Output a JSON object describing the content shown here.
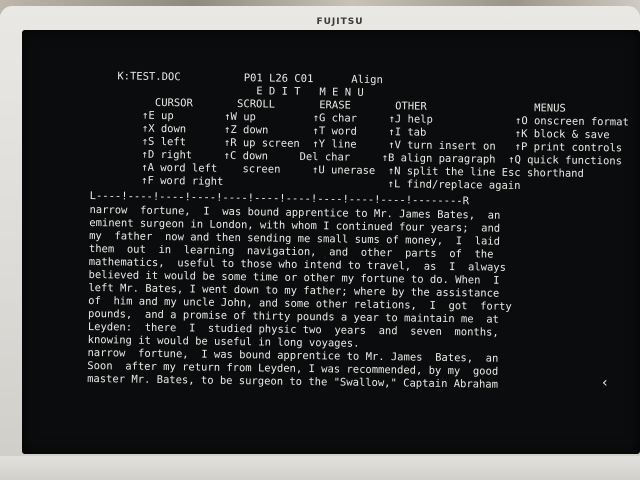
{
  "monitor": {
    "brand": "FUJITSU"
  },
  "editor": {
    "status_line": "K:TEST.DOC          P01 L26 C01      Align",
    "header_lines": [
      "                      E D I T   M E N U",
      "      CURSOR       SCROLL       ERASE       OTHER                 MENUS",
      "    ↑E up        ↑W up         ↑G char     ↑J help             ↑O onscreen format",
      "    ↑X down      ↑Z down       ↑T word     ↑I tab              ↑K block & save",
      "    ↑S left      ↑R up screen  ↑Y line     ↑V turn insert on   ↑P print controls",
      "    ↑D right     ↑C down     Del char     ↑B align paragraph  ↑Q quick functions",
      "    ↑A word left    screen     ↑U unerase  ↑N split the line Esc shorthand",
      "    ↑F word right                          ↑L find/replace again"
    ],
    "ruler": "L----!----!----!----!----!----!----!----!----!----!--------R",
    "text_lines": [
      "narrow  fortune,  I  was bound apprentice to Mr. James Bates,  an",
      "eminent surgeon in London, with whom I continued four years;  and",
      "my  father  now and then sending me small sums of money,  I  laid",
      "them  out  in  learning  navigation,  and  other  parts  of  the",
      "mathematics,  useful to those who intend to travel,  as  I  always",
      "believed it would be some time or other my fortune to do. When  I",
      "left Mr. Bates, I went down to my father; where by the assistance",
      "of  him and my uncle John, and some other relations,  I  got  forty",
      "pounds,  and a promise of thirty pounds a year to maintain me  at",
      "Leyden:  there  I  studied physic two  years  and  seven  months,",
      "knowing it would be useful in long voyages.",
      "narrow  fortune,  I was bound apprentice to Mr. James  Bates,  an",
      "Soon  after my return from Leyden, I was recommended, by my  good",
      "master Mr. Bates, to be surgeon to the \"Swallow,\" Captain Abraham"
    ],
    "cursor_glyph": "‹"
  }
}
